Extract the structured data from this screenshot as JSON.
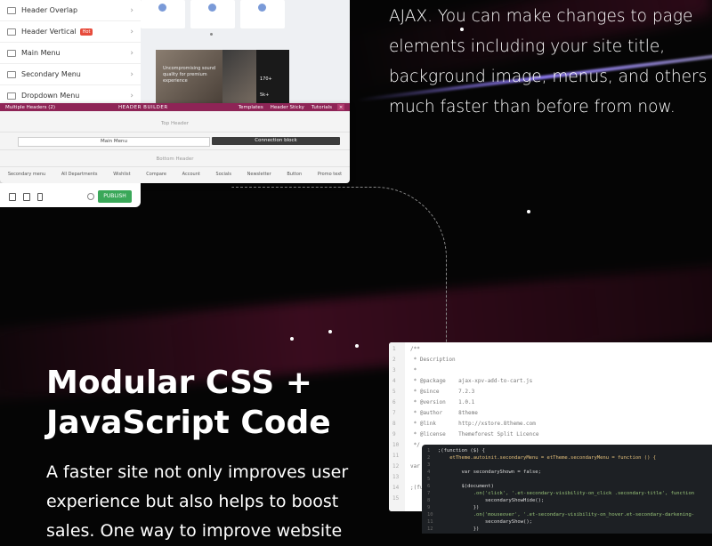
{
  "sidebar": {
    "items": [
      {
        "label": "Header Overlap",
        "badge": ""
      },
      {
        "label": "Header Vertical",
        "badge": "Hot"
      },
      {
        "label": "Main Menu",
        "badge": ""
      },
      {
        "label": "Secondary Menu",
        "badge": ""
      },
      {
        "label": "Dropdown Menu",
        "badge": ""
      }
    ]
  },
  "preview": {
    "hero_text": "Uncompromising sound quality for premium experience",
    "stat_value": "170+",
    "stat_value2": "5k+"
  },
  "builder": {
    "header_select": "Multiple Headers (2)",
    "title": "HEADER BUILDER",
    "templates": "Templates",
    "sticky": "Header Sticky",
    "tutorials": "Tutorials",
    "top_header": "Top Header",
    "main_menu": "Main Menu",
    "connection_block": "Connection block",
    "bottom_header": "Bottom Header",
    "elements": [
      "Secondary menu",
      "All Departments",
      "Wishlist",
      "Compare",
      "Account",
      "Socials",
      "Newsletter",
      "Button",
      "Promo text"
    ]
  },
  "footer": {
    "publish": "PUBLISH"
  },
  "copy": {
    "paragraph": "AJAX. You can make changes to page elements including your site title, background image, menus, and others much faster than before from now.",
    "heading": "Modular CSS + JavaScript Code",
    "body": "A faster site not only improves user experience but also helps to boost sales. One way to improve website"
  },
  "code_light": [
    "/**",
    " * Description",
    " *",
    " * @package    ajax-xpv-add-to-cart.js",
    " * @since      7.2.3",
    " * @version    1.0.1",
    " * @author     8theme",
    " * @link       http://xstore.8theme.com",
    " * @license    Themeforest Split Licence",
    " */",
    "",
    "var etAjaxVariableProducts;",
    "",
    ";(function ($) {",
    "    \"use strict\";"
  ],
  "code_dark": [
    ";(function ($) {",
    "    etTheme.autoinit.secondaryMenu = etTheme.secondaryMenu = function () {",
    "",
    "        var secondaryShown = false;",
    "",
    "        $(document)",
    "            .on('click', '.et-secondary-visibility-on_click .secondary-title', function",
    "                secondaryShowHide();",
    "            })",
    "            .on('mouseover', '.et-secondary-visibility-on_hover.et-secondary-darkening-",
    "                secondaryShow();",
    "            })",
    "            .on('mouseleave', '.et-secondary-visibility-on_hover.et-secondary-darkening"
  ],
  "colors": {
    "builder_bar": "#8e2456",
    "publish": "#3aa859",
    "background": "#050505"
  }
}
